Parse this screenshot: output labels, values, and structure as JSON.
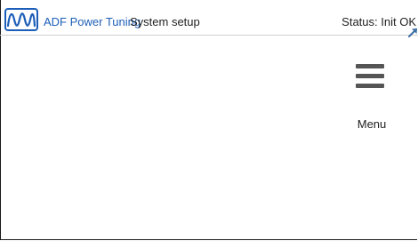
{
  "header": {
    "logo_icon": "adf-waveform-logo-icon",
    "brand": "ADF Power Tuning",
    "title": "System setup",
    "status_label": "Status:",
    "status_value": "Init OK"
  },
  "menu": {
    "icon": "hamburger-icon",
    "label": "Menu"
  },
  "colors": {
    "brand": "#1c5fb8",
    "text": "#222222",
    "icon": "#555555",
    "arrow": "#3b6ea5"
  }
}
